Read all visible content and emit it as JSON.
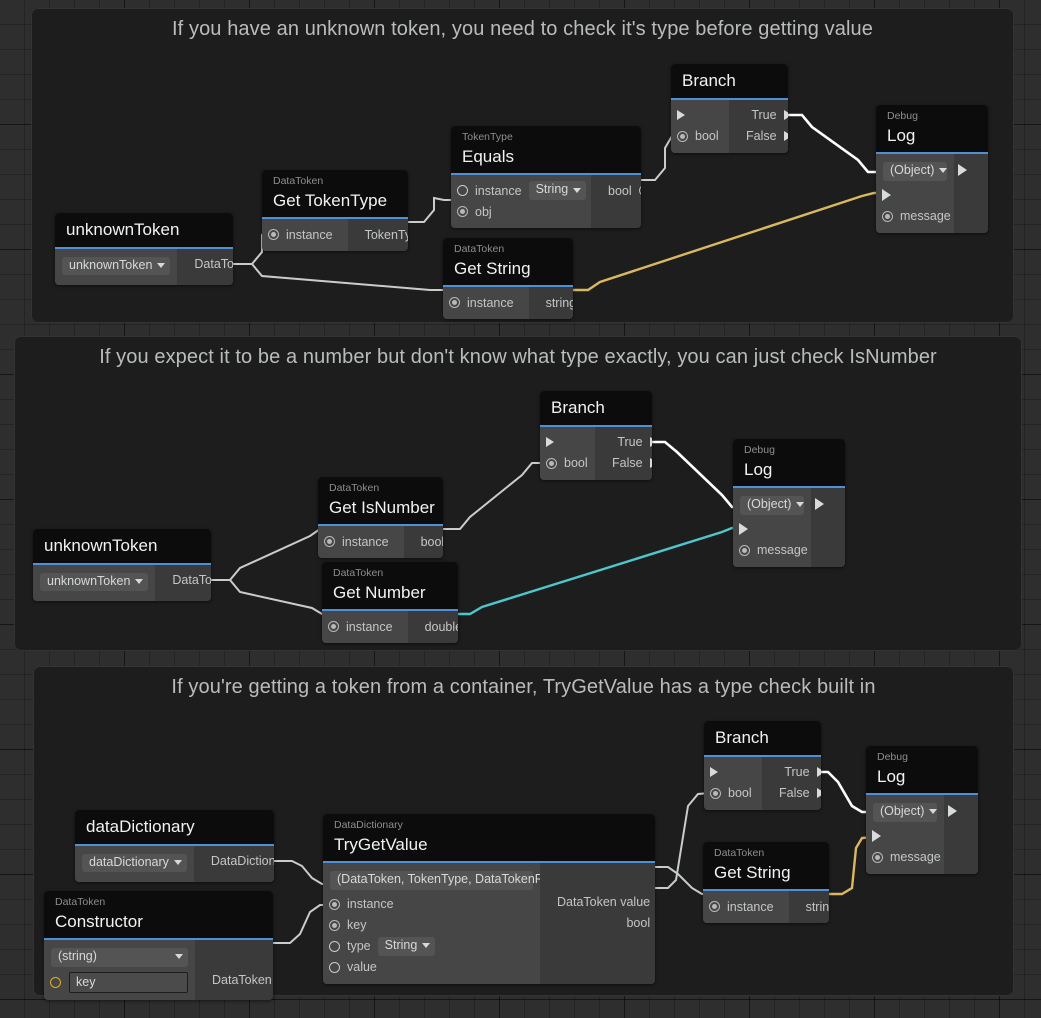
{
  "app": {
    "canvas_name": "udon-graph-canvas"
  },
  "groups": [
    {
      "id": "g1",
      "title": "If you have an unknown token, you need to check it's type before getting value"
    },
    {
      "id": "g2",
      "title": "If you expect it to be a number but don't know what type exactly, you can just check IsNumber"
    },
    {
      "id": "g3",
      "title": "If you're getting a token from a container, TryGetValue has a type check built in"
    }
  ],
  "nodes": {
    "unknownToken_1": {
      "subtitle": "",
      "title": "unknownToken",
      "dropdown": "unknownToken",
      "out_label": "DataToken"
    },
    "getTokenType": {
      "subtitle": "DataToken",
      "title": "Get TokenType",
      "in_label": "instance",
      "out_label": "TokenType"
    },
    "equals": {
      "subtitle": "TokenType",
      "title": "Equals",
      "in_instance": "instance",
      "dropdown": "String",
      "in_obj": "obj",
      "out_label": "bool"
    },
    "branch_1": {
      "subtitle": "",
      "title": "Branch",
      "in_bool": "bool",
      "out_true": "True",
      "out_false": "False"
    },
    "log_1": {
      "subtitle": "Debug",
      "title": "Log",
      "dropdown": "(Object)",
      "in_message": "message"
    },
    "getString_1": {
      "subtitle": "DataToken",
      "title": "Get String",
      "in_label": "instance",
      "out_label": "string"
    },
    "unknownToken_2": {
      "subtitle": "",
      "title": "unknownToken",
      "dropdown": "unknownToken",
      "out_label": "DataToken"
    },
    "getIsNumber": {
      "subtitle": "DataToken",
      "title": "Get IsNumber",
      "in_label": "instance",
      "out_label": "bool"
    },
    "getNumber": {
      "subtitle": "DataToken",
      "title": "Get Number",
      "in_label": "instance",
      "out_label": "double"
    },
    "branch_2": {
      "subtitle": "",
      "title": "Branch",
      "in_bool": "bool",
      "out_true": "True",
      "out_false": "False"
    },
    "log_2": {
      "subtitle": "Debug",
      "title": "Log",
      "dropdown": "(Object)",
      "in_message": "message"
    },
    "dataDictionary": {
      "subtitle": "",
      "title": "dataDictionary",
      "dropdown": "dataDictionary",
      "out_label": "DataDictionary"
    },
    "constructor": {
      "subtitle": "DataToken",
      "title": "Constructor",
      "dropdown": "(string)",
      "field_value": "key",
      "out_label": "DataToken"
    },
    "tryGetValue": {
      "subtitle": "DataDictionary",
      "title": "TryGetValue",
      "dropdown": "(DataToken, TokenType, DataTokenRef)",
      "in_instance": "instance",
      "in_key": "key",
      "in_type": "type",
      "type_dropdown": "String",
      "in_value": "value",
      "out_value": "DataToken value",
      "out_bool": "bool"
    },
    "branch_3": {
      "subtitle": "",
      "title": "Branch",
      "in_bool": "bool",
      "out_true": "True",
      "out_false": "False"
    },
    "getString_3": {
      "subtitle": "DataToken",
      "title": "Get String",
      "in_label": "instance",
      "out_label": "string"
    },
    "log_3": {
      "subtitle": "Debug",
      "title": "Log",
      "dropdown": "(Object)",
      "in_message": "message"
    }
  },
  "colors": {
    "accent_underline": "#4f8fd6",
    "wire_default": "#c9cccd",
    "wire_string": "#d9b860",
    "wire_double": "#4ec6cb",
    "node_header_bg": "#0c0c0c",
    "node_body_bg": "#3a3a3a",
    "group_bg": "#1d1d1d",
    "canvas_bg": "#2e2e2e"
  }
}
